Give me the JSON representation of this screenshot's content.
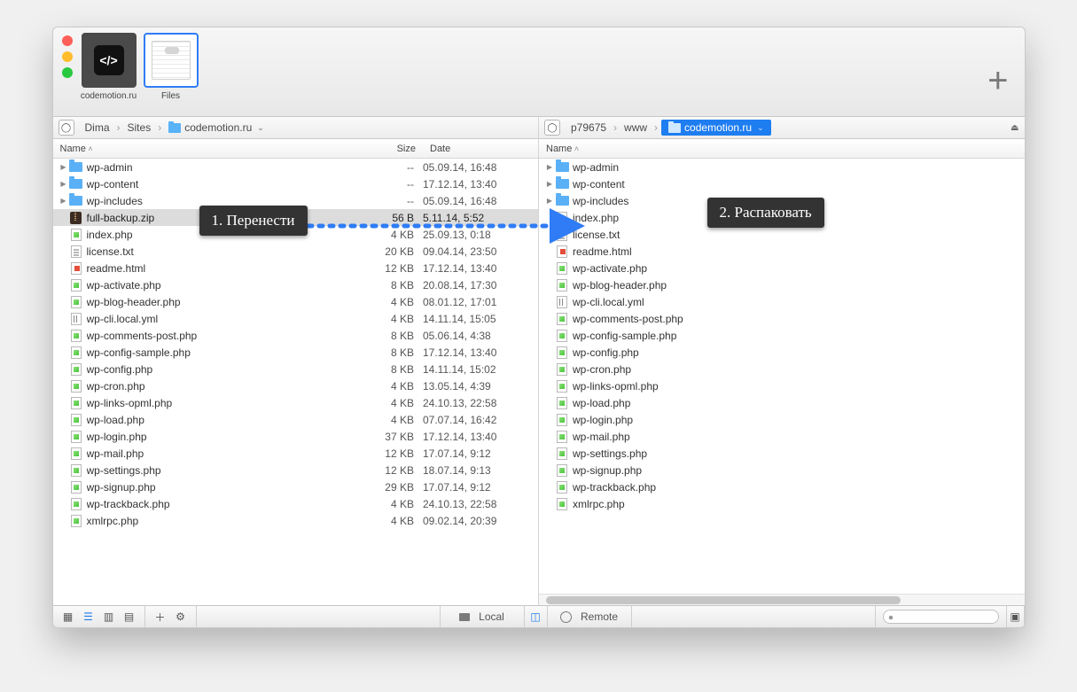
{
  "toolbar": {
    "tabs": [
      {
        "label": "codemotion.ru",
        "selected": false
      },
      {
        "label": "Files",
        "selected": true
      }
    ],
    "add_tab": "+"
  },
  "panes": {
    "left": {
      "breadcrumb": [
        "Dima",
        "Sites",
        "codemotion.ru"
      ],
      "active_crumb": 2,
      "columns": {
        "name": "Name",
        "size": "Size",
        "date": "Date"
      },
      "files": [
        {
          "k": "folder",
          "name": "wp-admin",
          "size": "--",
          "date": "05.09.14, 16:48",
          "exp": true
        },
        {
          "k": "folder",
          "name": "wp-content",
          "size": "--",
          "date": "17.12.14, 13:40",
          "exp": true
        },
        {
          "k": "folder",
          "name": "wp-includes",
          "size": "--",
          "date": "05.09.14, 16:48",
          "exp": true
        },
        {
          "k": "zip",
          "name": "full-backup.zip",
          "size": "56 B",
          "date": "5.11.14, 5:52",
          "sel": true
        },
        {
          "k": "php",
          "name": "index.php",
          "size": "4 KB",
          "date": "25.09.13, 0:18"
        },
        {
          "k": "txt",
          "name": "license.txt",
          "size": "20 KB",
          "date": "09.04.14, 23:50"
        },
        {
          "k": "html",
          "name": "readme.html",
          "size": "12 KB",
          "date": "17.12.14, 13:40"
        },
        {
          "k": "php",
          "name": "wp-activate.php",
          "size": "8 KB",
          "date": "20.08.14, 17:30"
        },
        {
          "k": "php",
          "name": "wp-blog-header.php",
          "size": "4 KB",
          "date": "08.01.12, 17:01"
        },
        {
          "k": "yml",
          "name": "wp-cli.local.yml",
          "size": "4 KB",
          "date": "14.11.14, 15:05"
        },
        {
          "k": "php",
          "name": "wp-comments-post.php",
          "size": "8 KB",
          "date": "05.06.14, 4:38"
        },
        {
          "k": "php",
          "name": "wp-config-sample.php",
          "size": "8 KB",
          "date": "17.12.14, 13:40"
        },
        {
          "k": "php",
          "name": "wp-config.php",
          "size": "8 KB",
          "date": "14.11.14, 15:02"
        },
        {
          "k": "php",
          "name": "wp-cron.php",
          "size": "4 KB",
          "date": "13.05.14, 4:39"
        },
        {
          "k": "php",
          "name": "wp-links-opml.php",
          "size": "4 KB",
          "date": "24.10.13, 22:58"
        },
        {
          "k": "php",
          "name": "wp-load.php",
          "size": "4 KB",
          "date": "07.07.14, 16:42"
        },
        {
          "k": "php",
          "name": "wp-login.php",
          "size": "37 KB",
          "date": "17.12.14, 13:40"
        },
        {
          "k": "php",
          "name": "wp-mail.php",
          "size": "12 KB",
          "date": "17.07.14, 9:12"
        },
        {
          "k": "php",
          "name": "wp-settings.php",
          "size": "12 KB",
          "date": "18.07.14, 9:13"
        },
        {
          "k": "php",
          "name": "wp-signup.php",
          "size": "29 KB",
          "date": "17.07.14, 9:12"
        },
        {
          "k": "php",
          "name": "wp-trackback.php",
          "size": "4 KB",
          "date": "24.10.13, 22:58"
        },
        {
          "k": "php",
          "name": "xmlrpc.php",
          "size": "4 KB",
          "date": "09.02.14, 20:39"
        }
      ]
    },
    "right": {
      "breadcrumb": [
        "p79675",
        "www",
        "codemotion.ru"
      ],
      "active_crumb": 2,
      "columns": {
        "name": "Name"
      },
      "files": [
        {
          "k": "folder",
          "name": "wp-admin",
          "exp": true
        },
        {
          "k": "folder",
          "name": "wp-content",
          "exp": true
        },
        {
          "k": "folder",
          "name": "wp-includes",
          "exp": true
        },
        {
          "k": "php",
          "name": "index.php"
        },
        {
          "k": "txt",
          "name": "license.txt"
        },
        {
          "k": "html",
          "name": "readme.html"
        },
        {
          "k": "php",
          "name": "wp-activate.php"
        },
        {
          "k": "php",
          "name": "wp-blog-header.php"
        },
        {
          "k": "yml",
          "name": "wp-cli.local.yml"
        },
        {
          "k": "php",
          "name": "wp-comments-post.php"
        },
        {
          "k": "php",
          "name": "wp-config-sample.php"
        },
        {
          "k": "php",
          "name": "wp-config.php"
        },
        {
          "k": "php",
          "name": "wp-cron.php"
        },
        {
          "k": "php",
          "name": "wp-links-opml.php"
        },
        {
          "k": "php",
          "name": "wp-load.php"
        },
        {
          "k": "php",
          "name": "wp-login.php"
        },
        {
          "k": "php",
          "name": "wp-mail.php"
        },
        {
          "k": "php",
          "name": "wp-settings.php"
        },
        {
          "k": "php",
          "name": "wp-signup.php"
        },
        {
          "k": "php",
          "name": "wp-trackback.php"
        },
        {
          "k": "php",
          "name": "xmlrpc.php"
        }
      ]
    }
  },
  "annotations": {
    "a1": "1. Перенести",
    "a2": "2. Распаковать"
  },
  "footer": {
    "local": "Local",
    "remote": "Remote",
    "search_placeholder": ""
  }
}
